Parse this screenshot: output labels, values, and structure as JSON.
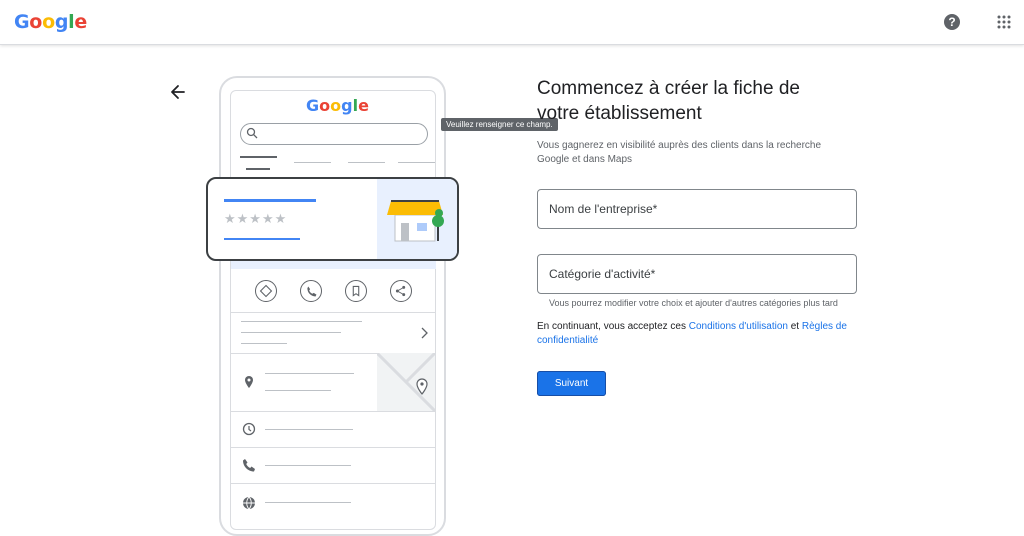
{
  "header": {
    "logo_letters": [
      {
        "char": "G",
        "color": "#4285F4"
      },
      {
        "char": "o",
        "color": "#EA4335"
      },
      {
        "char": "o",
        "color": "#FBBC05"
      },
      {
        "char": "g",
        "color": "#4285F4"
      },
      {
        "char": "l",
        "color": "#34A853"
      },
      {
        "char": "e",
        "color": "#EA4335"
      }
    ],
    "help_symbol": "?",
    "help_icon": "help-icon",
    "apps_icon": "apps-grid-icon"
  },
  "illustration": {
    "rating_stars": "★★★★★",
    "action_icons": [
      "directions-icon",
      "phone-icon",
      "bookmark-icon",
      "share-icon"
    ],
    "row_icons": [
      "location-pin-icon",
      "clock-icon",
      "phone-icon",
      "globe-icon"
    ]
  },
  "tooltip": "Veuillez renseigner ce champ.",
  "form": {
    "title": "Commencez à créer la fiche de votre établissement",
    "subtitle": "Vous gagnerez en visibilité auprès des clients dans la recherche Google et dans Maps",
    "business_name_placeholder": "Nom de l'entreprise*",
    "business_name_value": "",
    "category_placeholder": "Catégorie d'activité*",
    "category_value": "",
    "category_hint": "Vous pourrez modifier votre choix et ajouter d'autres catégories plus tard",
    "terms_prefix": "En continuant, vous acceptez ces ",
    "terms_link": "Conditions d'utilisation",
    "terms_and": " et ",
    "privacy_link": "Règles de confidentialité",
    "next_button": "Suivant"
  },
  "colors": {
    "accent": "#1a73e8",
    "store_awning": "#fbbc04",
    "tree": "#34a853"
  }
}
